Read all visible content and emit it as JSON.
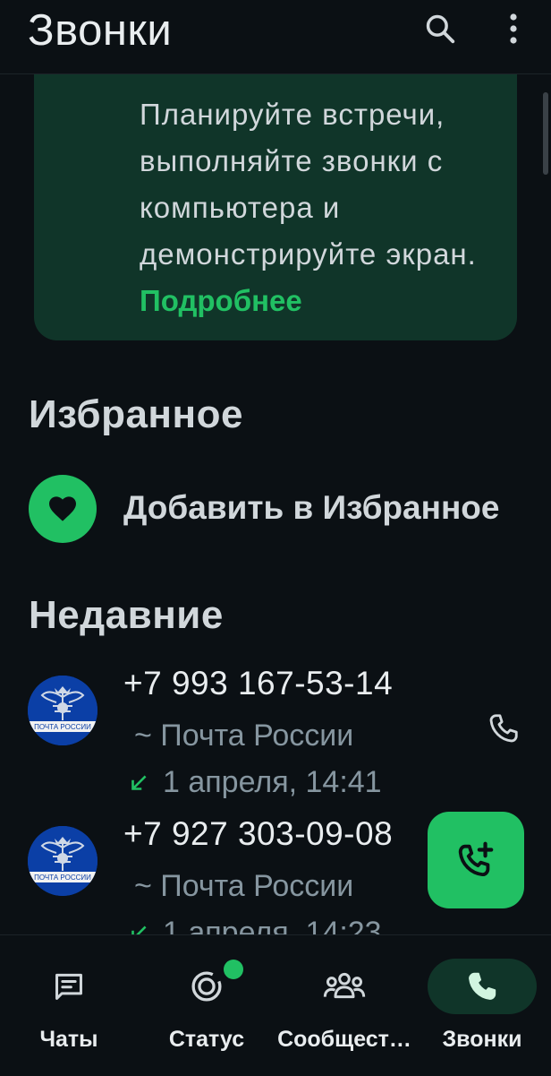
{
  "header": {
    "title": "Звонки",
    "search_icon": "search-icon",
    "more_icon": "more-vert-icon"
  },
  "promo": {
    "text": "Планируйте встречи, выполняйте звонки с компьютера и демонстрируйте экран.",
    "link": "Подробнее"
  },
  "favorites": {
    "heading": "Избранное",
    "add_label": "Добавить в Избранное",
    "icon": "heart-icon"
  },
  "recent": {
    "heading": "Недавние",
    "calls": [
      {
        "number": "+7 993 167-53-14",
        "name": "~ Почта России",
        "time": "1 апреля, 14:41",
        "direction": "incoming"
      },
      {
        "number": "+7 927 303-09-08",
        "name": "~ Почта России",
        "time": "1 апреля, 14:23",
        "direction": "incoming"
      }
    ]
  },
  "avatar_text": "ПОЧТА РОССИИ",
  "fab": {
    "icon": "add-call-icon"
  },
  "nav": {
    "items": [
      {
        "label": "Чаты",
        "icon": "chats-icon"
      },
      {
        "label": "Статус",
        "icon": "status-icon"
      },
      {
        "label": "Сообщест…",
        "icon": "communities-icon"
      },
      {
        "label": "Звонки",
        "icon": "calls-icon",
        "active": true
      }
    ]
  },
  "colors": {
    "accent": "#21c063",
    "background": "#0b1014",
    "promo_bg": "#103529"
  }
}
